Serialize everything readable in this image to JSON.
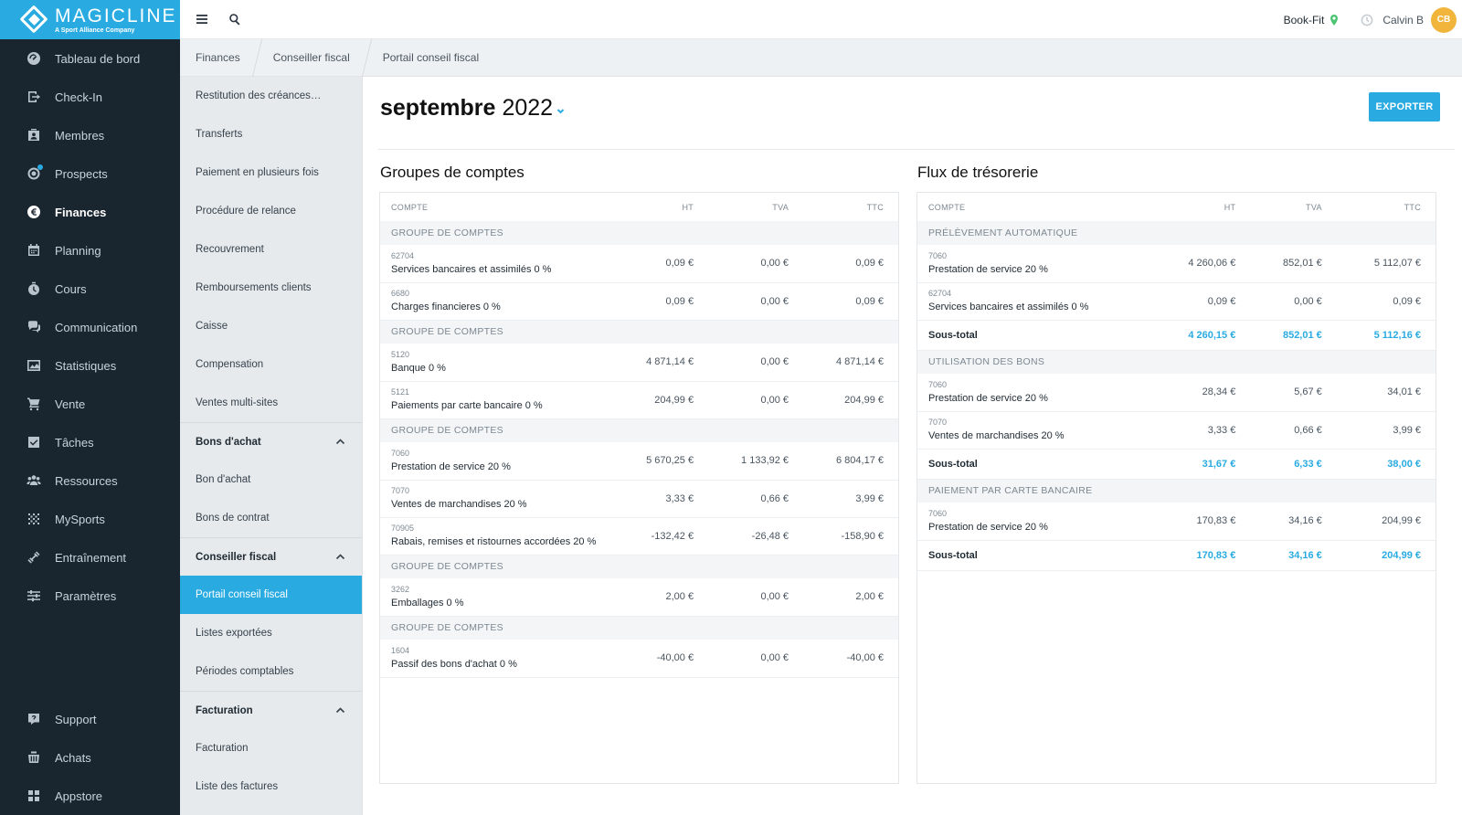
{
  "brand": {
    "name": "MAGICLINE",
    "tagline": "A Sport Alliance Company"
  },
  "nav": {
    "items": [
      {
        "label": "Tableau de bord",
        "icon": "dashboard-icon"
      },
      {
        "label": "Check-In",
        "icon": "check-in-icon"
      },
      {
        "label": "Membres",
        "icon": "members-icon"
      },
      {
        "label": "Prospects",
        "icon": "prospects-icon"
      },
      {
        "label": "Finances",
        "icon": "euro-icon",
        "active": true
      },
      {
        "label": "Planning",
        "icon": "calendar-icon"
      },
      {
        "label": "Cours",
        "icon": "timer-icon"
      },
      {
        "label": "Communication",
        "icon": "chat-icon"
      },
      {
        "label": "Statistiques",
        "icon": "chart-icon"
      },
      {
        "label": "Vente",
        "icon": "cart-icon"
      },
      {
        "label": "Tâches",
        "icon": "task-icon"
      },
      {
        "label": "Ressources",
        "icon": "resources-icon"
      },
      {
        "label": "MySports",
        "icon": "mysports-icon"
      },
      {
        "label": "Entraînement",
        "icon": "training-icon"
      },
      {
        "label": "Paramètres",
        "icon": "settings-icon"
      }
    ],
    "bottom": [
      {
        "label": "Support",
        "icon": "support-icon"
      },
      {
        "label": "Achats",
        "icon": "store-icon"
      },
      {
        "label": "Appstore",
        "icon": "apps-icon"
      }
    ]
  },
  "topbar": {
    "studio": "Book-Fit",
    "user": "Calvin B",
    "initials": "CB"
  },
  "breadcrumb": [
    "Finances",
    "Conseiller fiscal",
    "Portail conseil fiscal"
  ],
  "subnav": {
    "items_top": [
      "Restitution des créances…",
      "Transferts",
      "Paiement en plusieurs fois",
      "Procédure de relance",
      "Recouvrement",
      "Remboursements clients",
      "Caisse",
      "Compensation",
      "Ventes multi-sites"
    ],
    "group1": {
      "title": "Bons d'achat",
      "items": [
        "Bon d'achat",
        "Bons de contrat"
      ]
    },
    "group2": {
      "title": "Conseiller fiscal",
      "items": [
        "Portail conseil fiscal",
        "Listes exportées",
        "Périodes comptables"
      ]
    },
    "group3": {
      "title": "Facturation",
      "items": [
        "Facturation",
        "Liste des factures"
      ]
    }
  },
  "main": {
    "month": "septembre",
    "year": "2022",
    "export_label": "EXPORTER"
  },
  "groups_table": {
    "title": "Groupes de comptes",
    "columns": [
      "COMPTE",
      "HT",
      "TVA",
      "TTC"
    ],
    "groups": [
      {
        "label": "GROUPE DE COMPTES",
        "rows": [
          {
            "code": "62704",
            "name": "Services bancaires et assimilés 0 %",
            "ht": "0,09 €",
            "tva": "0,00 €",
            "ttc": "0,09 €"
          },
          {
            "code": "6680",
            "name": "Charges financieres 0 %",
            "ht": "0,09 €",
            "tva": "0,00 €",
            "ttc": "0,09 €"
          }
        ]
      },
      {
        "label": "GROUPE DE COMPTES",
        "rows": [
          {
            "code": "5120",
            "name": "Banque 0 %",
            "ht": "4 871,14 €",
            "tva": "0,00 €",
            "ttc": "4 871,14 €"
          },
          {
            "code": "5121",
            "name": "Paiements par carte bancaire 0 %",
            "ht": "204,99 €",
            "tva": "0,00 €",
            "ttc": "204,99 €"
          }
        ]
      },
      {
        "label": "GROUPE DE COMPTES",
        "rows": [
          {
            "code": "7060",
            "name": "Prestation de service 20 %",
            "ht": "5 670,25 €",
            "tva": "1 133,92 €",
            "ttc": "6 804,17 €"
          },
          {
            "code": "7070",
            "name": "Ventes de marchandises 20 %",
            "ht": "3,33 €",
            "tva": "0,66 €",
            "ttc": "3,99 €"
          },
          {
            "code": "70905",
            "name": "Rabais, remises et ristournes accordées 20 %",
            "ht": "-132,42 €",
            "tva": "-26,48 €",
            "ttc": "-158,90 €"
          }
        ]
      },
      {
        "label": "GROUPE DE COMPTES",
        "rows": [
          {
            "code": "3262",
            "name": "Emballages 0 %",
            "ht": "2,00 €",
            "tva": "0,00 €",
            "ttc": "2,00 €"
          }
        ]
      },
      {
        "label": "GROUPE DE COMPTES",
        "rows": [
          {
            "code": "1604",
            "name": "Passif des bons d'achat 0 %",
            "ht": "-40,00 €",
            "tva": "0,00 €",
            "ttc": "-40,00 €"
          }
        ]
      }
    ]
  },
  "flux_table": {
    "title": "Flux de trésorerie",
    "columns": [
      "COMPTE",
      "HT",
      "TVA",
      "TTC"
    ],
    "groups": [
      {
        "label": "PRÉLÈVEMENT AUTOMATIQUE",
        "rows": [
          {
            "code": "7060",
            "name": "Prestation de service 20 %",
            "ht": "4 260,06 €",
            "tva": "852,01 €",
            "ttc": "5 112,07 €"
          },
          {
            "code": "62704",
            "name": "Services bancaires et assimilés 0 %",
            "ht": "0,09 €",
            "tva": "0,00 €",
            "ttc": "0,09 €"
          }
        ],
        "subtotal": {
          "label": "Sous-total",
          "ht": "4 260,15 €",
          "tva": "852,01 €",
          "ttc": "5 112,16 €"
        }
      },
      {
        "label": "UTILISATION DES BONS",
        "rows": [
          {
            "code": "7060",
            "name": "Prestation de service 20 %",
            "ht": "28,34 €",
            "tva": "5,67 €",
            "ttc": "34,01 €"
          },
          {
            "code": "7070",
            "name": "Ventes de marchandises 20 %",
            "ht": "3,33 €",
            "tva": "0,66 €",
            "ttc": "3,99 €"
          }
        ],
        "subtotal": {
          "label": "Sous-total",
          "ht": "31,67 €",
          "tva": "6,33 €",
          "ttc": "38,00 €"
        }
      },
      {
        "label": "PAIEMENT PAR CARTE BANCAIRE",
        "rows": [
          {
            "code": "7060",
            "name": "Prestation de service 20 %",
            "ht": "170,83 €",
            "tva": "34,16 €",
            "ttc": "204,99 €"
          }
        ],
        "subtotal": {
          "label": "Sous-total",
          "ht": "170,83 €",
          "tva": "34,16 €",
          "ttc": "204,99 €"
        }
      }
    ]
  },
  "colors": {
    "accent": "#29abe2",
    "nav_bg": "#19252f",
    "subnav_bg": "#e6eaed",
    "avatar": "#f2b53c",
    "location_pin": "#4cc472"
  }
}
